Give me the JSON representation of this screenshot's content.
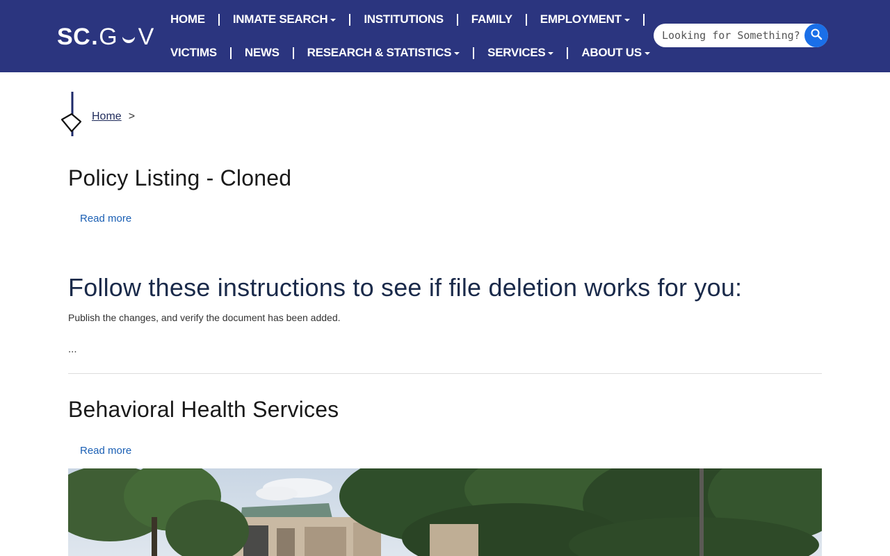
{
  "header": {
    "logo": {
      "sc": "SC",
      "dot": ".",
      "gov_g": "G",
      "gov_v": "V"
    },
    "nav_row1": [
      {
        "label": "HOME",
        "dropdown": false
      },
      {
        "label": "INMATE SEARCH",
        "dropdown": true
      },
      {
        "label": "INSTITUTIONS",
        "dropdown": false
      },
      {
        "label": "FAMILY",
        "dropdown": false
      },
      {
        "label": "EMPLOYMENT",
        "dropdown": true
      }
    ],
    "nav_row2": [
      {
        "label": "VICTIMS",
        "dropdown": false
      },
      {
        "label": "NEWS",
        "dropdown": false
      },
      {
        "label": "RESEARCH & STATISTICS",
        "dropdown": true
      },
      {
        "label": "SERVICES",
        "dropdown": true
      },
      {
        "label": "ABOUT US",
        "dropdown": true
      }
    ],
    "search": {
      "placeholder": "Looking for Something?",
      "value": ""
    },
    "colors": {
      "bar": "#2b357f",
      "search_button": "#1a6fe8"
    }
  },
  "breadcrumb": {
    "home": "Home",
    "separator": ">"
  },
  "main": {
    "items": [
      {
        "title": "Policy Listing - Cloned",
        "read_more": "Read more"
      },
      {
        "title": "Follow these instructions to see if file deletion works for you:",
        "body": "Publish the changes, and verify the document has been added.",
        "ellipsis": "..."
      },
      {
        "title": "Behavioral Health Services",
        "read_more": "Read more"
      }
    ]
  },
  "colors": {
    "link": "#1a5fb4",
    "breadcrumb_link": "#1e2a5a"
  }
}
